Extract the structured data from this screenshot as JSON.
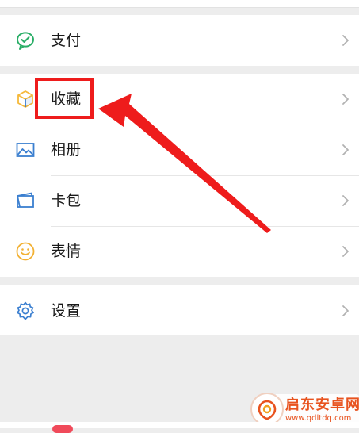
{
  "menu": {
    "pay": {
      "label": "支付",
      "icon": "wechat-pay-icon"
    },
    "favorites": {
      "label": "收藏",
      "icon": "favorites-cube-icon"
    },
    "album": {
      "label": "相册",
      "icon": "album-picture-icon"
    },
    "cards": {
      "label": "卡包",
      "icon": "card-wallet-icon"
    },
    "stickers": {
      "label": "表情",
      "icon": "smiley-face-icon"
    },
    "settings": {
      "label": "设置",
      "icon": "settings-gear-icon"
    }
  },
  "annotation": {
    "highlight_target": "收藏",
    "highlight_color": "#ee1c1c",
    "arrow_color": "#ee1c1c"
  },
  "watermark": {
    "title": "启东安卓网",
    "url": "www.qdltdq.com",
    "color": "#e8531f"
  },
  "colors": {
    "background": "#ededed",
    "row_background": "#ffffff",
    "pay_icon": "#2aae67",
    "cube_icon": "#f6b93b",
    "blue_icon": "#3b7fd0",
    "smiley_icon": "#f2b134",
    "chevron": "#b2b2b2"
  }
}
